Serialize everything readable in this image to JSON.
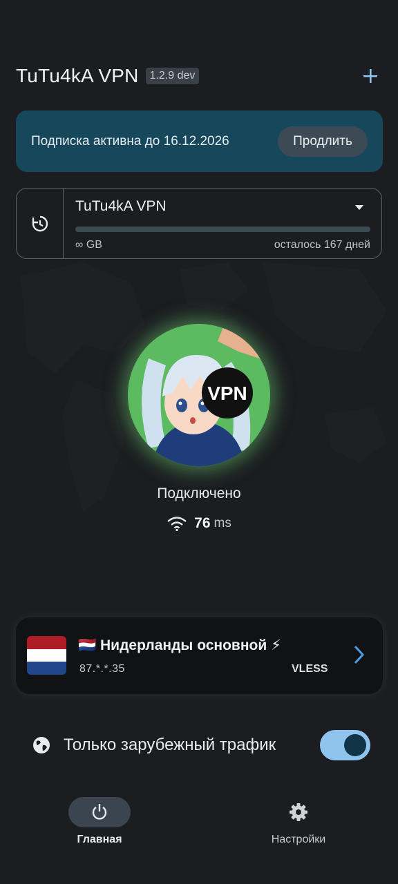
{
  "header": {
    "title": "TuTu4kA VPN",
    "version": "1.2.9 dev",
    "add_icon": "plus-icon"
  },
  "subscription": {
    "text": "Подписка активна до 16.12.2026",
    "renew_label": "Продлить"
  },
  "profile": {
    "name": "TuTu4kA VPN",
    "traffic": "∞ GB",
    "remaining": "осталось 167 дней",
    "usage_fraction": 0,
    "refresh_icon": "refresh-clock-icon",
    "dropdown_icon": "caret-down-icon"
  },
  "connection": {
    "avatar_badge": "VPN",
    "status": "Подключено",
    "ping_value": "76",
    "ping_unit": "ms",
    "ping_icon": "wifi-icon",
    "glow_color": "#66bb6a"
  },
  "server": {
    "flag_emoji": "🇳🇱",
    "name": "Нидерланды основной ⚡",
    "ip": "87.*.*.35",
    "protocol": "VLESS",
    "flag_colors": [
      "#ae1c28",
      "#ffffff",
      "#21468b"
    ]
  },
  "toggle": {
    "label": "Только зарубежный трафик",
    "enabled": true,
    "icon": "globe-icon"
  },
  "nav": [
    {
      "label": "Главная",
      "icon": "power-icon",
      "active": true
    },
    {
      "label": "Настройки",
      "icon": "gear-icon",
      "active": false
    }
  ],
  "colors": {
    "accent": "#8ec4ee",
    "card": "#17475a",
    "background": "#1b1d20"
  }
}
